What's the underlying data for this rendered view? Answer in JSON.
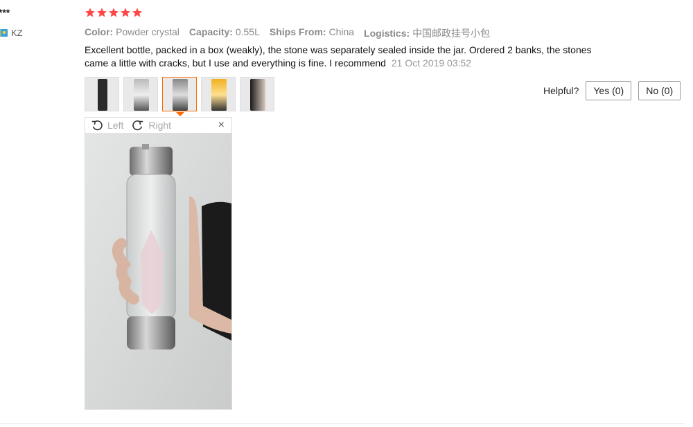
{
  "user": {
    "name": "l***",
    "country_code": "KZ",
    "flag_icon": "kazakhstan-flag-icon"
  },
  "rating": {
    "stars": 5,
    "max": 5,
    "color": "#ff4747"
  },
  "attributes": [
    {
      "label": "Color:",
      "value": "Powder crystal"
    },
    {
      "label": "Capacity:",
      "value": "0.55L"
    },
    {
      "label": "Ships From:",
      "value": "China"
    },
    {
      "label": "Logistics:",
      "value": "中国邮政挂号小包"
    }
  ],
  "review": {
    "text": "Excellent bottle, packed in a box (weakly), the stone was separately sealed inside the jar. Ordered 2 banks, the stones came a little with cracks, but I use and everything is fine. I recommend",
    "date": "21 Oct 2019 03:52"
  },
  "thumbnails": {
    "count": 5,
    "selected_index": 2
  },
  "viewer": {
    "rotate_left_label": "Left",
    "rotate_right_label": "Right",
    "close_label": "×"
  },
  "helpful": {
    "label": "Helpful?",
    "yes_label": "Yes (0)",
    "no_label": "No (0)"
  },
  "colors": {
    "accent": "#ff6a00",
    "muted_text": "#8a8a8a"
  }
}
